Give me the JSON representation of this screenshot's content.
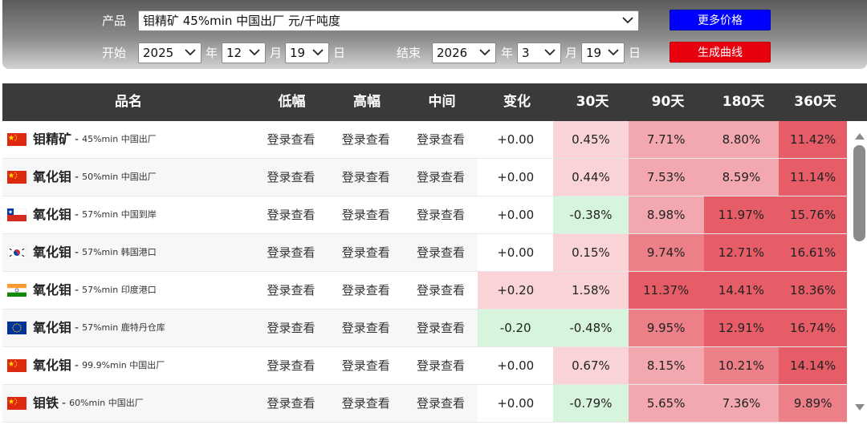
{
  "form": {
    "product_label": "产品",
    "product_value": "钼精矿 45%min 中国出厂 元/千吨度",
    "start_label": "开始",
    "start_year": "2025",
    "start_month": "12",
    "start_day": "19",
    "end_label": "结束",
    "end_year": "2026",
    "end_month": "3",
    "end_day": "19",
    "year_unit": "年",
    "month_unit": "月",
    "day_unit": "日",
    "more_prices_button": "更多价格",
    "generate_curve_button": "生成曲线"
  },
  "table": {
    "headers": [
      "品名",
      "低幅",
      "高幅",
      "中间",
      "变化",
      "30天",
      "90天",
      "180天",
      "360天"
    ],
    "rows": [
      {
        "flag": "china-flag-icon",
        "name": "钼精矿",
        "spec": "45%min 中国出厂",
        "low": "登录查看",
        "high": "登录查看",
        "mid": "登录查看",
        "change": "+0.00",
        "d30": "0.45%",
        "d90": "7.71%",
        "d180": "8.80%",
        "d360": "11.42%"
      },
      {
        "flag": "china-flag-icon",
        "name": "氧化钼",
        "spec": "50%min 中国出厂",
        "low": "登录查看",
        "high": "登录查看",
        "mid": "登录查看",
        "change": "+0.00",
        "d30": "0.44%",
        "d90": "7.53%",
        "d180": "8.59%",
        "d360": "11.14%"
      },
      {
        "flag": "chile-flag-icon",
        "name": "氧化钼",
        "spec": "57%min 中国到岸",
        "low": "登录查看",
        "high": "登录查看",
        "mid": "登录查看",
        "change": "+0.00",
        "d30": "-0.38%",
        "d90": "8.98%",
        "d180": "11.97%",
        "d360": "15.76%"
      },
      {
        "flag": "korea-flag-icon",
        "name": "氧化钼",
        "spec": "57%min 韩国港口",
        "low": "登录查看",
        "high": "登录查看",
        "mid": "登录查看",
        "change": "+0.00",
        "d30": "0.15%",
        "d90": "9.74%",
        "d180": "12.71%",
        "d360": "16.61%"
      },
      {
        "flag": "india-flag-icon",
        "name": "氧化钼",
        "spec": "57%min 印度港口",
        "low": "登录查看",
        "high": "登录查看",
        "mid": "登录查看",
        "change": "+0.20",
        "d30": "1.58%",
        "d90": "11.37%",
        "d180": "14.41%",
        "d360": "18.36%"
      },
      {
        "flag": "eu-flag-icon",
        "name": "氧化钼",
        "spec": "57%min 鹿特丹仓库",
        "low": "登录查看",
        "high": "登录查看",
        "mid": "登录查看",
        "change": "-0.20",
        "d30": "-0.48%",
        "d90": "9.95%",
        "d180": "12.91%",
        "d360": "16.74%"
      },
      {
        "flag": "china-flag-icon",
        "name": "氧化钼",
        "spec": "99.9%min 中国出厂",
        "low": "登录查看",
        "high": "登录查看",
        "mid": "登录查看",
        "change": "+0.00",
        "d30": "0.67%",
        "d90": "8.15%",
        "d180": "10.21%",
        "d360": "14.14%"
      },
      {
        "flag": "china-flag-icon",
        "name": "钼铁",
        "spec": "60%min 中国出厂",
        "low": "登录查看",
        "high": "登录查看",
        "mid": "登录查看",
        "change": "+0.00",
        "d30": "-0.79%",
        "d90": "5.65%",
        "d180": "7.36%",
        "d360": "9.89%"
      }
    ]
  },
  "colors": {
    "header_bg": "#3a3a3a",
    "more_button": "#0000ff",
    "curve_button": "#e8000e",
    "positive_light": "#f9d3d6",
    "positive_mid": "#f2a8ae",
    "positive_strong": "#ec7f88",
    "positive_max": "#e65c67",
    "negative_light": "#d6f5dc"
  },
  "icons": {
    "dropdown": "chevron-down-icon",
    "scroll_up": "triangle-up-icon",
    "scroll_down": "triangle-down-icon"
  }
}
